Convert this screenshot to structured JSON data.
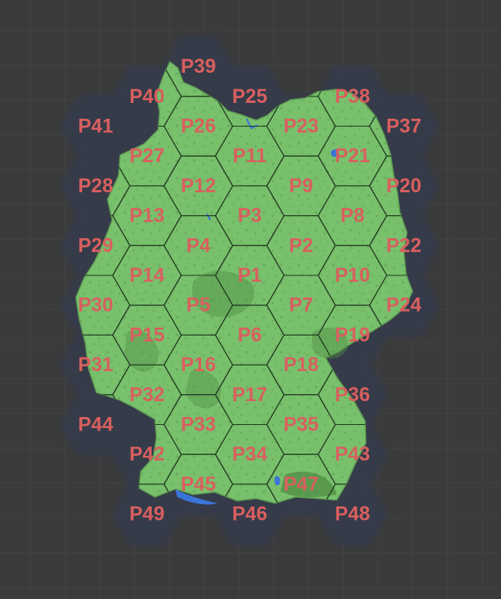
{
  "colors": {
    "background": "#3b3b3b",
    "grid": "#454545",
    "shadow": "#343b4a",
    "land": "#78c06c",
    "hexLine": "#1f3a1f",
    "label": "#d95f5f",
    "water": "#3a74d8"
  },
  "map": {
    "type": "hex-grid-over-germany",
    "labels": [
      {
        "id": "P1",
        "q": 0,
        "r": 0
      },
      {
        "id": "P2",
        "q": 1,
        "r": -1
      },
      {
        "id": "P3",
        "q": 0,
        "r": -2
      },
      {
        "id": "P4",
        "q": -1,
        "r": -1
      },
      {
        "id": "P5",
        "q": -1,
        "r": 1
      },
      {
        "id": "P6",
        "q": 0,
        "r": 2
      },
      {
        "id": "P7",
        "q": 1,
        "r": 1
      },
      {
        "id": "P8",
        "q": 2,
        "r": -2
      },
      {
        "id": "P9",
        "q": 1,
        "r": -3
      },
      {
        "id": "P10",
        "q": 2,
        "r": 0
      },
      {
        "id": "P11",
        "q": 0,
        "r": -4
      },
      {
        "id": "P12",
        "q": -1,
        "r": -3
      },
      {
        "id": "P13",
        "q": -2,
        "r": -2
      },
      {
        "id": "P14",
        "q": -2,
        "r": 0
      },
      {
        "id": "P15",
        "q": -2,
        "r": 2
      },
      {
        "id": "P16",
        "q": -1,
        "r": 3
      },
      {
        "id": "P17",
        "q": 0,
        "r": 4
      },
      {
        "id": "P18",
        "q": 1,
        "r": 3
      },
      {
        "id": "P19",
        "q": 2,
        "r": 2
      },
      {
        "id": "P20",
        "q": 3,
        "r": -3
      },
      {
        "id": "P21",
        "q": 2,
        "r": -4
      },
      {
        "id": "P22",
        "q": 3,
        "r": -1
      },
      {
        "id": "P23",
        "q": 1,
        "r": -5
      },
      {
        "id": "P24",
        "q": 3,
        "r": 1
      },
      {
        "id": "P25",
        "q": 0,
        "r": -6
      },
      {
        "id": "P26",
        "q": -1,
        "r": -5
      },
      {
        "id": "P27",
        "q": -2,
        "r": -4
      },
      {
        "id": "P28",
        "q": -3,
        "r": -3
      },
      {
        "id": "P29",
        "q": -3,
        "r": -1
      },
      {
        "id": "P30",
        "q": -3,
        "r": 1
      },
      {
        "id": "P31",
        "q": -3,
        "r": 3
      },
      {
        "id": "P32",
        "q": -2,
        "r": 4
      },
      {
        "id": "P33",
        "q": -1,
        "r": 5
      },
      {
        "id": "P34",
        "q": 0,
        "r": 6
      },
      {
        "id": "P35",
        "q": 1,
        "r": 5
      },
      {
        "id": "P36",
        "q": 2,
        "r": 4
      },
      {
        "id": "P37",
        "q": 3,
        "r": -5
      },
      {
        "id": "P38",
        "q": 2,
        "r": -6
      },
      {
        "id": "P39",
        "q": -1,
        "r": -7
      },
      {
        "id": "P40",
        "q": -2,
        "r": -6
      },
      {
        "id": "P41",
        "q": -3,
        "r": -5
      },
      {
        "id": "P42",
        "q": -2,
        "r": 6
      },
      {
        "id": "P43",
        "q": 2,
        "r": 6
      },
      {
        "id": "P44",
        "q": -3,
        "r": 5
      },
      {
        "id": "P45",
        "q": -1,
        "r": 7
      },
      {
        "id": "P46",
        "q": 0,
        "r": 8
      },
      {
        "id": "P47",
        "q": 1,
        "r": 7
      },
      {
        "id": "P48",
        "q": 2,
        "r": 8
      },
      {
        "id": "P49",
        "q": -2,
        "r": 8
      }
    ]
  }
}
